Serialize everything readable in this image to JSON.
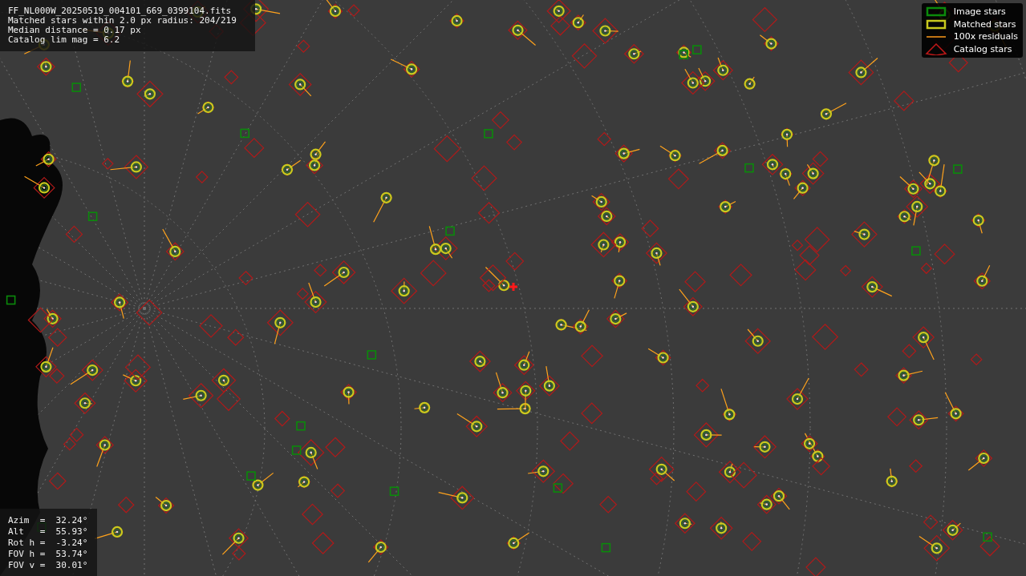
{
  "info": {
    "lines": [
      "FF_NL000W_20250519_004101_669_0399104.fits",
      "Matched stars within 2.0 px radius: 204/219",
      "Median distance = 0.17 px",
      "Catalog lim mag = 6.2"
    ]
  },
  "legend": {
    "entries": [
      {
        "kind": "image",
        "label": "Image stars"
      },
      {
        "kind": "matched",
        "label": "Matched stars"
      },
      {
        "kind": "residual",
        "label": "100x residuals"
      },
      {
        "kind": "catalog",
        "label": "Catalog stars"
      }
    ]
  },
  "pointing": {
    "lines": [
      "Azim  =  32.24°",
      "Alt   =  55.93°",
      "Rot h =  -3.24°",
      "FOV h =  53.74°",
      "FOV v =  30.01°"
    ]
  }
}
